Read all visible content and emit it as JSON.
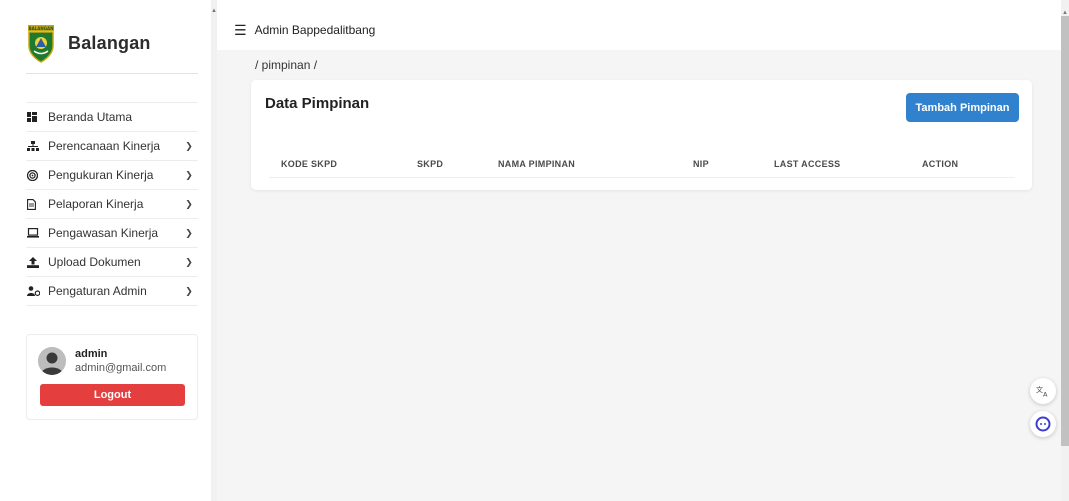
{
  "brand": {
    "name": "Balangan",
    "logo_icon": "balangan-emblem-icon",
    "logo_banner_text": "BALANGAN"
  },
  "sidebar": {
    "items": [
      {
        "label": "Beranda Utama",
        "icon": "dashboard-icon",
        "has_submenu": false
      },
      {
        "label": "Perencanaan Kinerja",
        "icon": "sitemap-icon",
        "has_submenu": true
      },
      {
        "label": "Pengukuran Kinerja",
        "icon": "target-icon",
        "has_submenu": true
      },
      {
        "label": "Pelaporan Kinerja",
        "icon": "file-icon",
        "has_submenu": true
      },
      {
        "label": "Pengawasan Kinerja",
        "icon": "monitor-icon",
        "has_submenu": true
      },
      {
        "label": "Upload Dokumen",
        "icon": "upload-icon",
        "has_submenu": true
      },
      {
        "label": "Pengaturan Admin",
        "icon": "users-cog-icon",
        "has_submenu": true
      }
    ]
  },
  "user": {
    "name": "admin",
    "email": "admin@gmail.com",
    "logout_label": "Logout"
  },
  "topbar": {
    "title": "Admin Bappedalitbang"
  },
  "breadcrumb": "/ pimpinan /",
  "card": {
    "title": "Data Pimpinan",
    "add_button_label": "Tambah Pimpinan",
    "columns": [
      "KODE SKPD",
      "SKPD",
      "NAMA PIMPINAN",
      "NIP",
      "LAST ACCESS",
      "ACTION"
    ],
    "rows": []
  },
  "floating": {
    "translate_icon": "translate-icon",
    "chat_icon": "chat-assistant-icon"
  },
  "colors": {
    "primary": "#3182ce",
    "danger": "#e53e3e",
    "background": "#f5f5f5"
  }
}
